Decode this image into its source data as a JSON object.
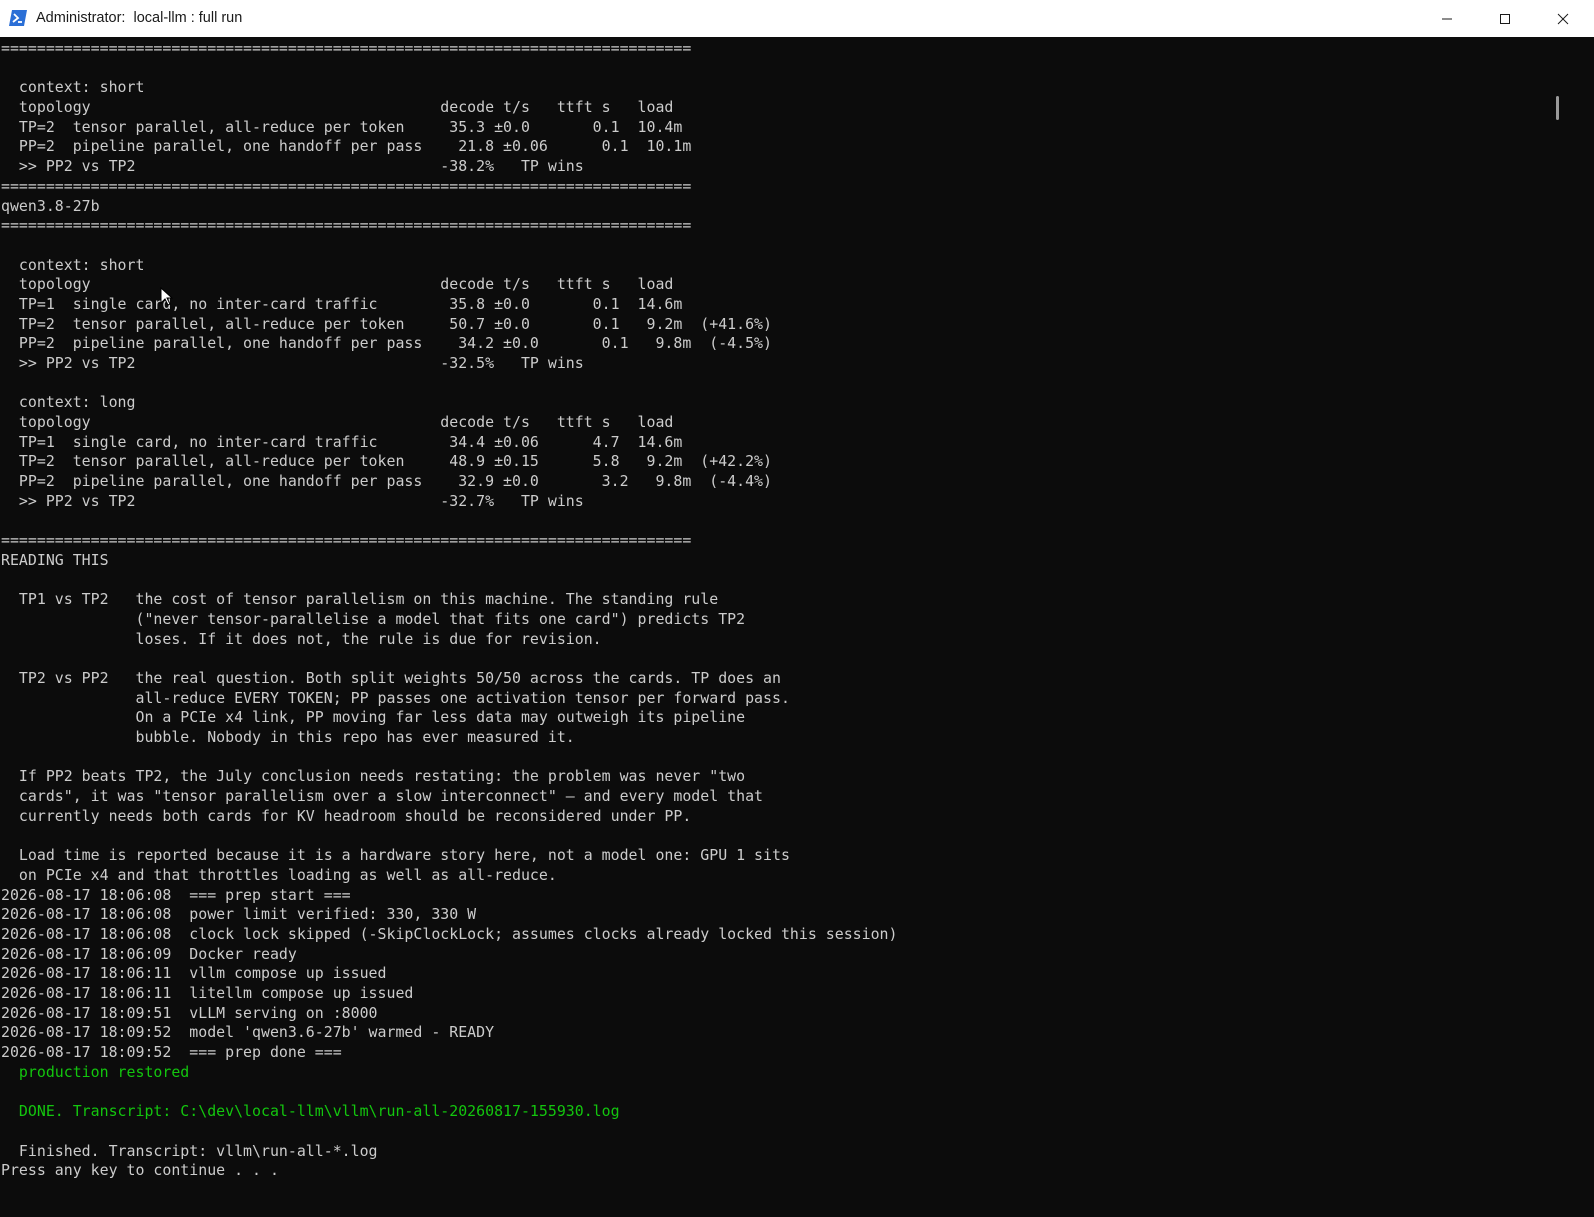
{
  "window": {
    "title": "Administrator:  local-llm : full run",
    "controls": {
      "minimize": "minimize",
      "maximize": "maximize",
      "close": "close"
    }
  },
  "icons": {
    "app": "powershell-icon",
    "pointer": "mouse-pointer-icon"
  },
  "colors": {
    "console_bg": "#0c0c0c",
    "console_text": "#cccccc",
    "success_text": "#13c60e",
    "titlebar_bg": "#ffffff"
  },
  "console": {
    "lines": [
      {
        "text": "============================================================================="
      },
      {
        "text": ""
      },
      {
        "text": "  context: short"
      },
      {
        "text": "  topology                                       decode t/s   ttft s   load"
      },
      {
        "text": "  TP=2  tensor parallel, all-reduce per token     35.3 ±0.0       0.1  10.4m"
      },
      {
        "text": "  PP=2  pipeline parallel, one handoff per pass    21.8 ±0.06      0.1  10.1m"
      },
      {
        "text": "  >> PP2 vs TP2                                  -38.2%   TP wins"
      },
      {
        "text": "============================================================================="
      },
      {
        "text": "qwen3.8-27b"
      },
      {
        "text": "============================================================================="
      },
      {
        "text": ""
      },
      {
        "text": "  context: short"
      },
      {
        "text": "  topology                                       decode t/s   ttft s   load"
      },
      {
        "text": "  TP=1  single card, no inter-card traffic        35.8 ±0.0       0.1  14.6m"
      },
      {
        "text": "  TP=2  tensor parallel, all-reduce per token     50.7 ±0.0       0.1   9.2m  (+41.6%)"
      },
      {
        "text": "  PP=2  pipeline parallel, one handoff per pass    34.2 ±0.0       0.1   9.8m  (-4.5%)"
      },
      {
        "text": "  >> PP2 vs TP2                                  -32.5%   TP wins"
      },
      {
        "text": ""
      },
      {
        "text": "  context: long"
      },
      {
        "text": "  topology                                       decode t/s   ttft s   load"
      },
      {
        "text": "  TP=1  single card, no inter-card traffic        34.4 ±0.06      4.7  14.6m"
      },
      {
        "text": "  TP=2  tensor parallel, all-reduce per token     48.9 ±0.15      5.8   9.2m  (+42.2%)"
      },
      {
        "text": "  PP=2  pipeline parallel, one handoff per pass    32.9 ±0.0       3.2   9.8m  (-4.4%)"
      },
      {
        "text": "  >> PP2 vs TP2                                  -32.7%   TP wins"
      },
      {
        "text": ""
      },
      {
        "text": "============================================================================="
      },
      {
        "text": "READING THIS"
      },
      {
        "text": ""
      },
      {
        "text": "  TP1 vs TP2   the cost of tensor parallelism on this machine. The standing rule"
      },
      {
        "text": "               (\"never tensor-parallelise a model that fits one card\") predicts TP2"
      },
      {
        "text": "               loses. If it does not, the rule is due for revision."
      },
      {
        "text": ""
      },
      {
        "text": "  TP2 vs PP2   the real question. Both split weights 50/50 across the cards. TP does an"
      },
      {
        "text": "               all-reduce EVERY TOKEN; PP passes one activation tensor per forward pass."
      },
      {
        "text": "               On a PCIe x4 link, PP moving far less data may outweigh its pipeline"
      },
      {
        "text": "               bubble. Nobody in this repo has ever measured it."
      },
      {
        "text": ""
      },
      {
        "text": "  If PP2 beats TP2, the July conclusion needs restating: the problem was never \"two"
      },
      {
        "text": "  cards\", it was \"tensor parallelism over a slow interconnect\" — and every model that"
      },
      {
        "text": "  currently needs both cards for KV headroom should be reconsidered under PP."
      },
      {
        "text": ""
      },
      {
        "text": "  Load time is reported because it is a hardware story here, not a model one: GPU 1 sits"
      },
      {
        "text": "  on PCIe x4 and that throttles loading as well as all-reduce."
      },
      {
        "text": "2026-08-17 18:06:08  === prep start ==="
      },
      {
        "text": "2026-08-17 18:06:08  power limit verified: 330, 330 W"
      },
      {
        "text": "2026-08-17 18:06:08  clock lock skipped (-SkipClockLock; assumes clocks already locked this session)"
      },
      {
        "text": "2026-08-17 18:06:09  Docker ready"
      },
      {
        "text": "2026-08-17 18:06:11  vllm compose up issued"
      },
      {
        "text": "2026-08-17 18:06:11  litellm compose up issued"
      },
      {
        "text": "2026-08-17 18:09:51  vLLM serving on :8000"
      },
      {
        "text": "2026-08-17 18:09:52  model 'qwen3.6-27b' warmed - READY"
      },
      {
        "text": "2026-08-17 18:09:52  === prep done ==="
      },
      {
        "text": "  production restored",
        "color": "green"
      },
      {
        "text": ""
      },
      {
        "text": "  DONE. Transcript: C:\\dev\\local-llm\\vllm\\run-all-20260817-155930.log",
        "color": "green"
      },
      {
        "text": ""
      },
      {
        "text": "  Finished. Transcript: vllm\\run-all-*.log"
      },
      {
        "text": "Press any key to continue . . ."
      }
    ]
  }
}
